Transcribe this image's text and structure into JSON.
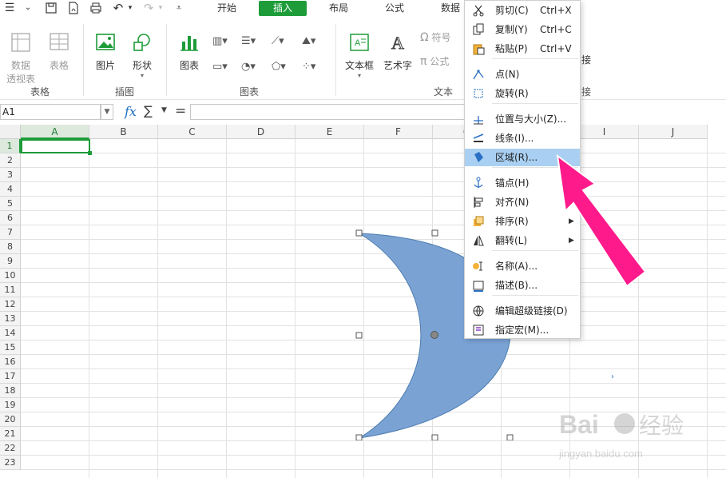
{
  "quickbar": {
    "icons": [
      "menu-chevron-icon",
      "save-icon",
      "pdf-export-icon",
      "print-icon",
      "undo-icon",
      "undo-dropdown-icon",
      "redo-icon",
      "redo-dropdown-icon",
      "customize-icon"
    ]
  },
  "tabs": [
    {
      "label": "开始",
      "active": false
    },
    {
      "label": "插入",
      "active": true
    },
    {
      "label": "布局",
      "active": false
    },
    {
      "label": "公式",
      "active": false
    },
    {
      "label": "数据",
      "active": false
    }
  ],
  "ribbon": {
    "pivot_table_line1": "数据",
    "pivot_table_line2": "透视表",
    "table": "表格",
    "picture": "图片",
    "shapes": "形状",
    "chart": "图表",
    "textbox": "文本框",
    "wordart": "艺术字",
    "symbol": "符号",
    "equation": "公式",
    "hyperlink_fragment": "接",
    "groups": {
      "tables": "表格",
      "illustrations": "插图",
      "charts": "图表",
      "text": "文本",
      "links_fragment": "接"
    }
  },
  "formula_bar": {
    "name_box": "A1",
    "fx": "fx",
    "sigma": "∑",
    "equals": "="
  },
  "grid": {
    "columns": [
      "A",
      "B",
      "C",
      "D",
      "E",
      "F",
      "G",
      "H",
      "I",
      "J"
    ],
    "rows": [
      "1",
      "2",
      "3",
      "4",
      "5",
      "6",
      "7",
      "8",
      "9",
      "10",
      "11",
      "12",
      "13",
      "14",
      "15",
      "16",
      "17",
      "18",
      "19",
      "20",
      "21",
      "22",
      "23"
    ],
    "selected_cell": "A1"
  },
  "context_menu": {
    "items": [
      {
        "label": "剪切(C)",
        "shortcut": "Ctrl+X",
        "icon": "scissors-icon"
      },
      {
        "label": "复制(Y)",
        "shortcut": "Ctrl+C",
        "icon": "copy-icon"
      },
      {
        "label": "粘贴(P)",
        "shortcut": "Ctrl+V",
        "icon": "paste-icon"
      },
      {
        "label": "点(N)",
        "icon": "edit-points-icon"
      },
      {
        "label": "旋转(R)",
        "icon": "rotate-icon"
      },
      {
        "label": "位置与大小(Z)...",
        "icon": "position-size-icon"
      },
      {
        "label": "线条(I)...",
        "icon": "line-style-icon"
      },
      {
        "label": "区域(R)...",
        "icon": "fill-area-icon",
        "highlighted": true
      },
      {
        "label": "锚点(H)",
        "icon": "anchor-icon"
      },
      {
        "label": "对齐(N)",
        "icon": "align-icon",
        "submenu": true
      },
      {
        "label": "排序(R)",
        "icon": "order-icon",
        "submenu": true
      },
      {
        "label": "翻转(L)",
        "icon": "flip-icon",
        "submenu": true
      },
      {
        "label": "名称(A)...",
        "icon": "name-icon"
      },
      {
        "label": "描述(B)...",
        "icon": "description-icon"
      },
      {
        "label": "编辑超级链接(D)",
        "icon": "hyperlink-icon"
      },
      {
        "label": "指定宏(M)...",
        "icon": "assign-macro-icon"
      }
    ]
  },
  "shape": {
    "type": "moon",
    "fill": "#7aa3d4",
    "stroke": "#4d7bb0"
  },
  "annotation": {
    "arrow_color": "#ff1a8c"
  },
  "watermark": {
    "brand": "Baidu经验",
    "url": "jingyan.baidu.com"
  }
}
